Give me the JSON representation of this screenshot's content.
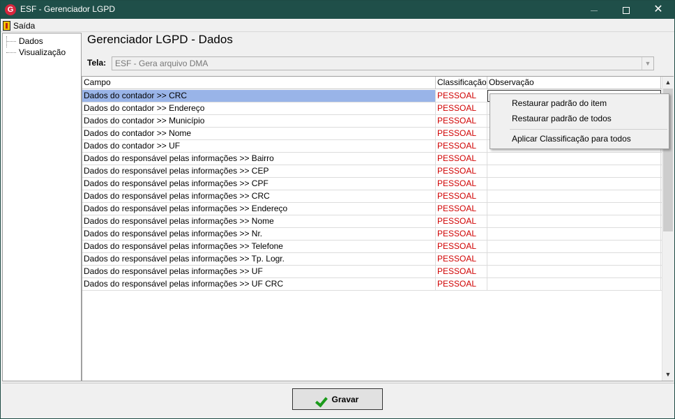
{
  "window": {
    "title": "ESF - Gerenciador LGPD",
    "app_icon_letter": "G",
    "minimize_label": "",
    "close_label": "✕"
  },
  "menu": {
    "exit_label": "Saída"
  },
  "tree": {
    "items": [
      "Dados",
      "Visualização"
    ]
  },
  "main": {
    "heading": "Gerenciador LGPD - Dados",
    "tela_label": "Tela:",
    "tela_value": "ESF - Gera arquivo DMA"
  },
  "grid": {
    "columns": [
      "Campo",
      "Classificação",
      "Observação"
    ],
    "rows": [
      {
        "campo": "Dados do contador >> CRC",
        "classificacao": "PESSOAL",
        "observacao": ""
      },
      {
        "campo": "Dados do contador >> Endereço",
        "classificacao": "PESSOAL",
        "observacao": ""
      },
      {
        "campo": "Dados do contador >> Município",
        "classificacao": "PESSOAL",
        "observacao": ""
      },
      {
        "campo": "Dados do contador >> Nome",
        "classificacao": "PESSOAL",
        "observacao": ""
      },
      {
        "campo": "Dados do contador >> UF",
        "classificacao": "PESSOAL",
        "observacao": ""
      },
      {
        "campo": "Dados do responsável pelas informações >> Bairro",
        "classificacao": "PESSOAL",
        "observacao": ""
      },
      {
        "campo": "Dados do responsável pelas informações >> CEP",
        "classificacao": "PESSOAL",
        "observacao": ""
      },
      {
        "campo": "Dados do responsável pelas informações >> CPF",
        "classificacao": "PESSOAL",
        "observacao": ""
      },
      {
        "campo": "Dados do responsável pelas informações >> CRC",
        "classificacao": "PESSOAL",
        "observacao": ""
      },
      {
        "campo": "Dados do responsável pelas informações >> Endereço",
        "classificacao": "PESSOAL",
        "observacao": ""
      },
      {
        "campo": "Dados do responsável pelas informações >> Nome",
        "classificacao": "PESSOAL",
        "observacao": ""
      },
      {
        "campo": "Dados do responsável pelas informações >> Nr.",
        "classificacao": "PESSOAL",
        "observacao": ""
      },
      {
        "campo": "Dados do responsável pelas informações >> Telefone",
        "classificacao": "PESSOAL",
        "observacao": ""
      },
      {
        "campo": "Dados do responsável pelas informações >> Tp. Logr.",
        "classificacao": "PESSOAL",
        "observacao": ""
      },
      {
        "campo": "Dados do responsável pelas informações >> UF",
        "classificacao": "PESSOAL",
        "observacao": ""
      },
      {
        "campo": "Dados do responsável pelas informações >> UF CRC",
        "classificacao": "PESSOAL",
        "observacao": ""
      }
    ],
    "selected_row": 0
  },
  "context_menu": {
    "items": [
      "Restaurar padrão do item",
      "Restaurar padrão de todos",
      "Aplicar Classificação para todos"
    ]
  },
  "footer": {
    "save_label": "Gravar"
  },
  "colors": {
    "titlebar": "#1f4f49",
    "selection": "#99b4e8",
    "classification_text": "#d00000",
    "check_green": "#1a9a1a"
  }
}
